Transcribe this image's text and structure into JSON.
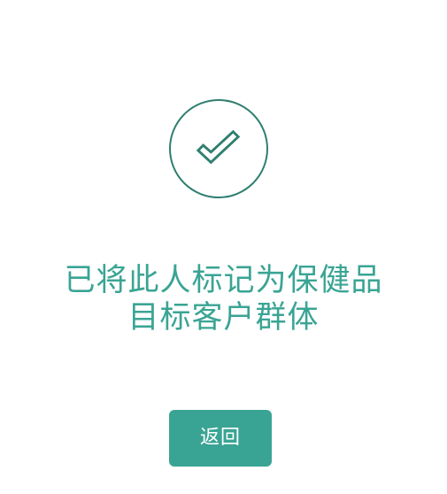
{
  "result": {
    "icon": "check-icon",
    "message_line_1": "已将此人标记为保健品",
    "message_line_2": "目标客户群体"
  },
  "actions": {
    "back_label": "返回"
  },
  "colors": {
    "accent": "#3aa494",
    "icon_stroke": "#2f7f70",
    "background": "#ffffff",
    "button_text": "#ffffff"
  }
}
